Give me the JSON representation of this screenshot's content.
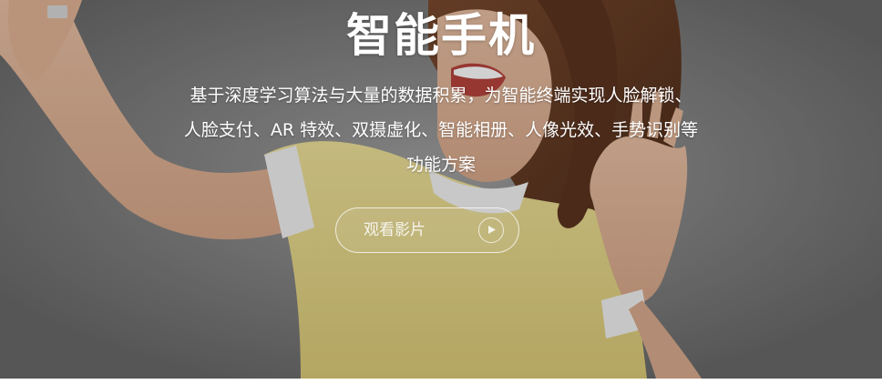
{
  "hero": {
    "title": "智能手机",
    "description": "基于深度学习算法与大量的数据积累，为智能终端实现人脸解锁、人脸支付、AR 特效、双摄虚化、智能相册、人像光效、手势识别等功能方案",
    "watch_button_label": "观看影片",
    "play_icon": "play-icon"
  },
  "colors": {
    "text": "#ffffff",
    "shirt": "#e9d98a",
    "background": "#7d7d7d"
  }
}
